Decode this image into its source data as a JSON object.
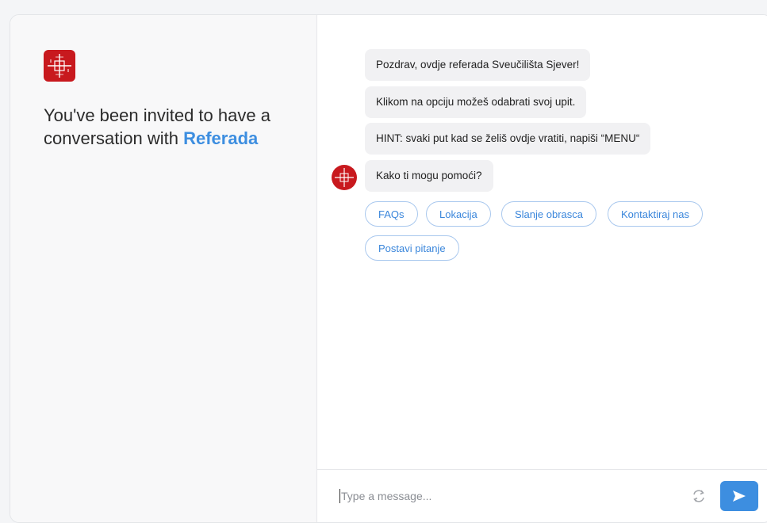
{
  "brand": {
    "name": "Referada",
    "accent_color": "#3d8ee0",
    "logo_color": "#c8191e",
    "logo_icon": "crosshair-logo-icon"
  },
  "invite": {
    "prefix": "You've been invited to have a conversation with ",
    "bot_name": "Referada"
  },
  "messages": [
    {
      "text": "Pozdrav, ovdje referada Sveučilišta Sjever!"
    },
    {
      "text": "Klikom na opciju možeš odabrati svoj upit."
    },
    {
      "text": "HINT: svaki put kad se želiš ovdje vratiti, napiši “MENU“"
    },
    {
      "text": "Kako ti mogu pomoći?"
    }
  ],
  "quick_replies": [
    {
      "label": "FAQs"
    },
    {
      "label": "Lokacija"
    },
    {
      "label": "Slanje obrasca"
    },
    {
      "label": "Kontaktiraj nas"
    },
    {
      "label": "Postavi pitanje"
    }
  ],
  "composer": {
    "placeholder": "Type a message...",
    "value": "",
    "refresh_icon": "refresh-icon",
    "send_icon": "send-icon"
  }
}
